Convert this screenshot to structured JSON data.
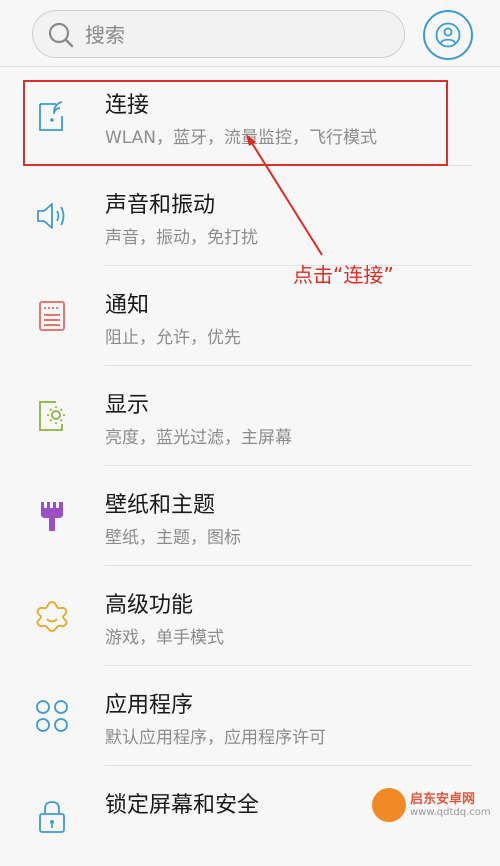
{
  "search": {
    "placeholder": "搜索"
  },
  "items": [
    {
      "title": "连接",
      "subtitle": "WLAN，蓝牙，流量监控，飞行模式",
      "icon": "connection-icon",
      "color": "#3c9bd5"
    },
    {
      "title": "声音和振动",
      "subtitle": "声音，振动，免打扰",
      "icon": "sound-icon",
      "color": "#3c9bd5"
    },
    {
      "title": "通知",
      "subtitle": "阻止，允许，优先",
      "icon": "notification-icon",
      "color": "#e06a5b"
    },
    {
      "title": "显示",
      "subtitle": "亮度，蓝光过滤，主屏幕",
      "icon": "display-icon",
      "color": "#8ab43c"
    },
    {
      "title": "壁纸和主题",
      "subtitle": "壁纸，主题，图标",
      "icon": "theme-brush-icon",
      "color": "#9b4fc2"
    },
    {
      "title": "高级功能",
      "subtitle": "游戏，单手模式",
      "icon": "advanced-features-icon",
      "color": "#e3a925"
    },
    {
      "title": "应用程序",
      "subtitle": "默认应用程序，应用程序许可",
      "icon": "apps-icon",
      "color": "#3c9bd5"
    },
    {
      "title": "锁定屏幕和安全",
      "subtitle": "",
      "icon": "lock-icon",
      "color": "#3c9bd5"
    }
  ],
  "annotation": {
    "text": "点击“连接”",
    "color": "#e02a22"
  },
  "watermark": {
    "name": "启东安卓网",
    "url": "www.qdtdq.com"
  }
}
